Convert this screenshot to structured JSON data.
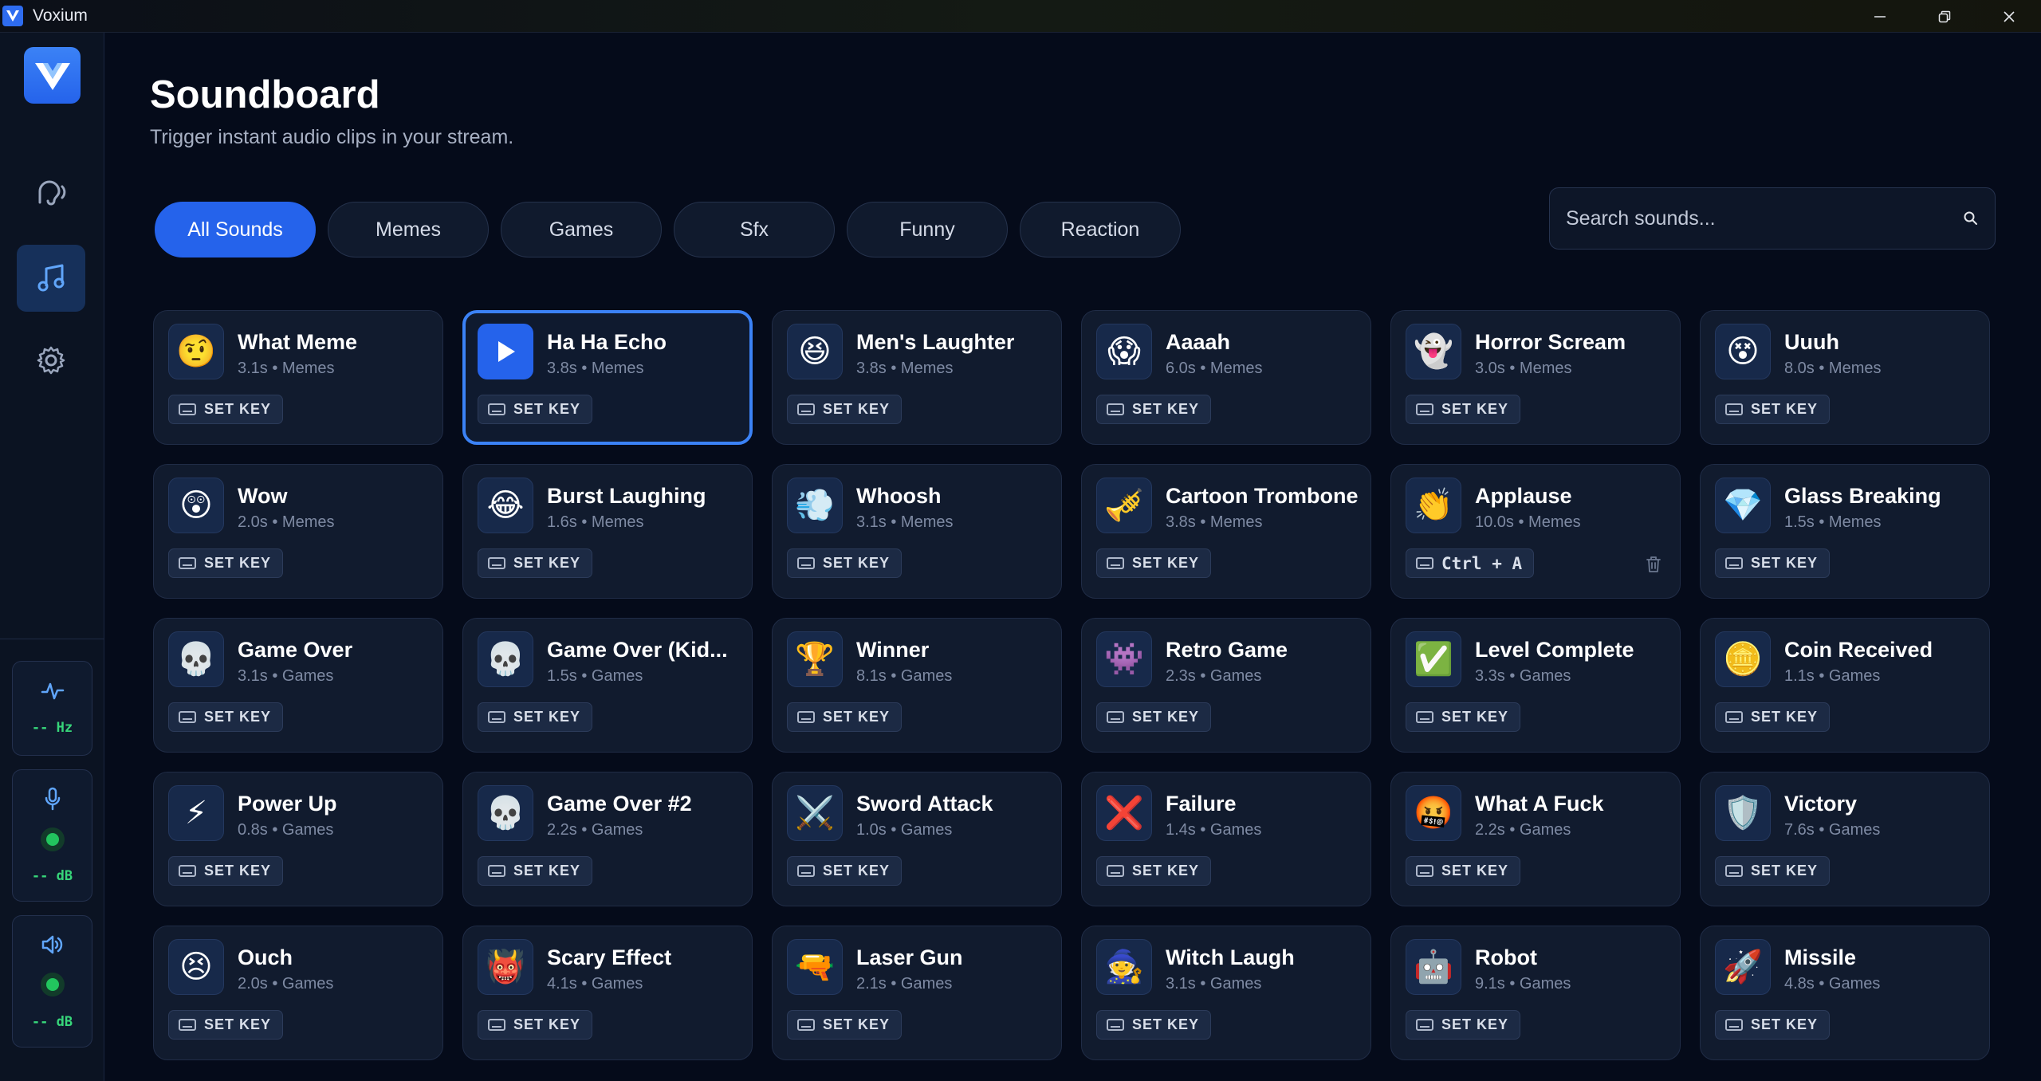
{
  "window": {
    "title": "Voxium"
  },
  "sidebar": {
    "meters": [
      {
        "name": "pitch",
        "value": "-- Hz"
      },
      {
        "name": "mic",
        "value": "-- dB"
      },
      {
        "name": "output",
        "value": "-- dB"
      }
    ]
  },
  "header": {
    "title": "Soundboard",
    "subtitle": "Trigger instant audio clips in your stream."
  },
  "filters": [
    "All Sounds",
    "Memes",
    "Games",
    "Sfx",
    "Funny",
    "Reaction"
  ],
  "active_filter": "All Sounds",
  "search": {
    "placeholder": "Search sounds..."
  },
  "set_key_label": "SET KEY",
  "sounds": [
    {
      "name": "What Meme",
      "meta": "3.1s • Memes",
      "icon": "🤨",
      "key": ""
    },
    {
      "name": "Ha Ha Echo",
      "meta": "3.8s • Memes",
      "icon": "play-icon",
      "key": "",
      "selected": true
    },
    {
      "name": "Men's Laughter",
      "meta": "3.8s • Memes",
      "icon": "😆",
      "key": ""
    },
    {
      "name": "Aaaah",
      "meta": "6.0s • Memes",
      "icon": "😱",
      "key": ""
    },
    {
      "name": "Horror Scream",
      "meta": "3.0s • Memes",
      "icon": "👻",
      "key": ""
    },
    {
      "name": "Uuuh",
      "meta": "8.0s • Memes",
      "icon": "😵",
      "key": ""
    },
    {
      "name": "Wow",
      "meta": "2.0s • Memes",
      "icon": "😲",
      "key": ""
    },
    {
      "name": "Burst Laughing",
      "meta": "1.6s • Memes",
      "icon": "😂",
      "key": ""
    },
    {
      "name": "Whoosh",
      "meta": "3.1s • Memes",
      "icon": "💨",
      "key": ""
    },
    {
      "name": "Cartoon Trombone",
      "meta": "3.8s • Memes",
      "icon": "🎺",
      "key": ""
    },
    {
      "name": "Applause",
      "meta": "10.0s • Memes",
      "icon": "👏",
      "key": "Ctrl + A"
    },
    {
      "name": "Glass Breaking",
      "meta": "1.5s • Memes",
      "icon": "💎",
      "key": ""
    },
    {
      "name": "Game Over",
      "meta": "3.1s • Games",
      "icon": "💀",
      "key": ""
    },
    {
      "name": "Game Over (Kid...",
      "meta": "1.5s • Games",
      "icon": "💀",
      "key": ""
    },
    {
      "name": "Winner",
      "meta": "8.1s • Games",
      "icon": "🏆",
      "key": ""
    },
    {
      "name": "Retro Game",
      "meta": "2.3s • Games",
      "icon": "👾",
      "key": ""
    },
    {
      "name": "Level Complete",
      "meta": "3.3s • Games",
      "icon": "✅",
      "key": ""
    },
    {
      "name": "Coin Received",
      "meta": "1.1s • Games",
      "icon": "🪙",
      "key": ""
    },
    {
      "name": "Power Up",
      "meta": "0.8s • Games",
      "icon": "⚡",
      "key": ""
    },
    {
      "name": "Game Over #2",
      "meta": "2.2s • Games",
      "icon": "💀",
      "key": ""
    },
    {
      "name": "Sword Attack",
      "meta": "1.0s • Games",
      "icon": "⚔️",
      "key": ""
    },
    {
      "name": "Failure",
      "meta": "1.4s • Games",
      "icon": "❌",
      "key": ""
    },
    {
      "name": "What A Fuck",
      "meta": "2.2s • Games",
      "icon": "🤬",
      "key": ""
    },
    {
      "name": "Victory",
      "meta": "7.6s • Games",
      "icon": "🛡️",
      "key": ""
    },
    {
      "name": "Ouch",
      "meta": "2.0s • Games",
      "icon": "😣",
      "key": ""
    },
    {
      "name": "Scary Effect",
      "meta": "4.1s • Games",
      "icon": "👹",
      "key": ""
    },
    {
      "name": "Laser Gun",
      "meta": "2.1s • Games",
      "icon": "🔫",
      "key": ""
    },
    {
      "name": "Witch Laugh",
      "meta": "3.1s • Games",
      "icon": "🧙",
      "key": ""
    },
    {
      "name": "Robot",
      "meta": "9.1s • Games",
      "icon": "🤖",
      "key": ""
    },
    {
      "name": "Missile",
      "meta": "4.8s • Games",
      "icon": "🚀",
      "key": ""
    }
  ],
  "colors": {
    "accent": "#2563eb",
    "background": "#050b1a",
    "card": "#111b2e",
    "level_ok": "#22c55e"
  }
}
